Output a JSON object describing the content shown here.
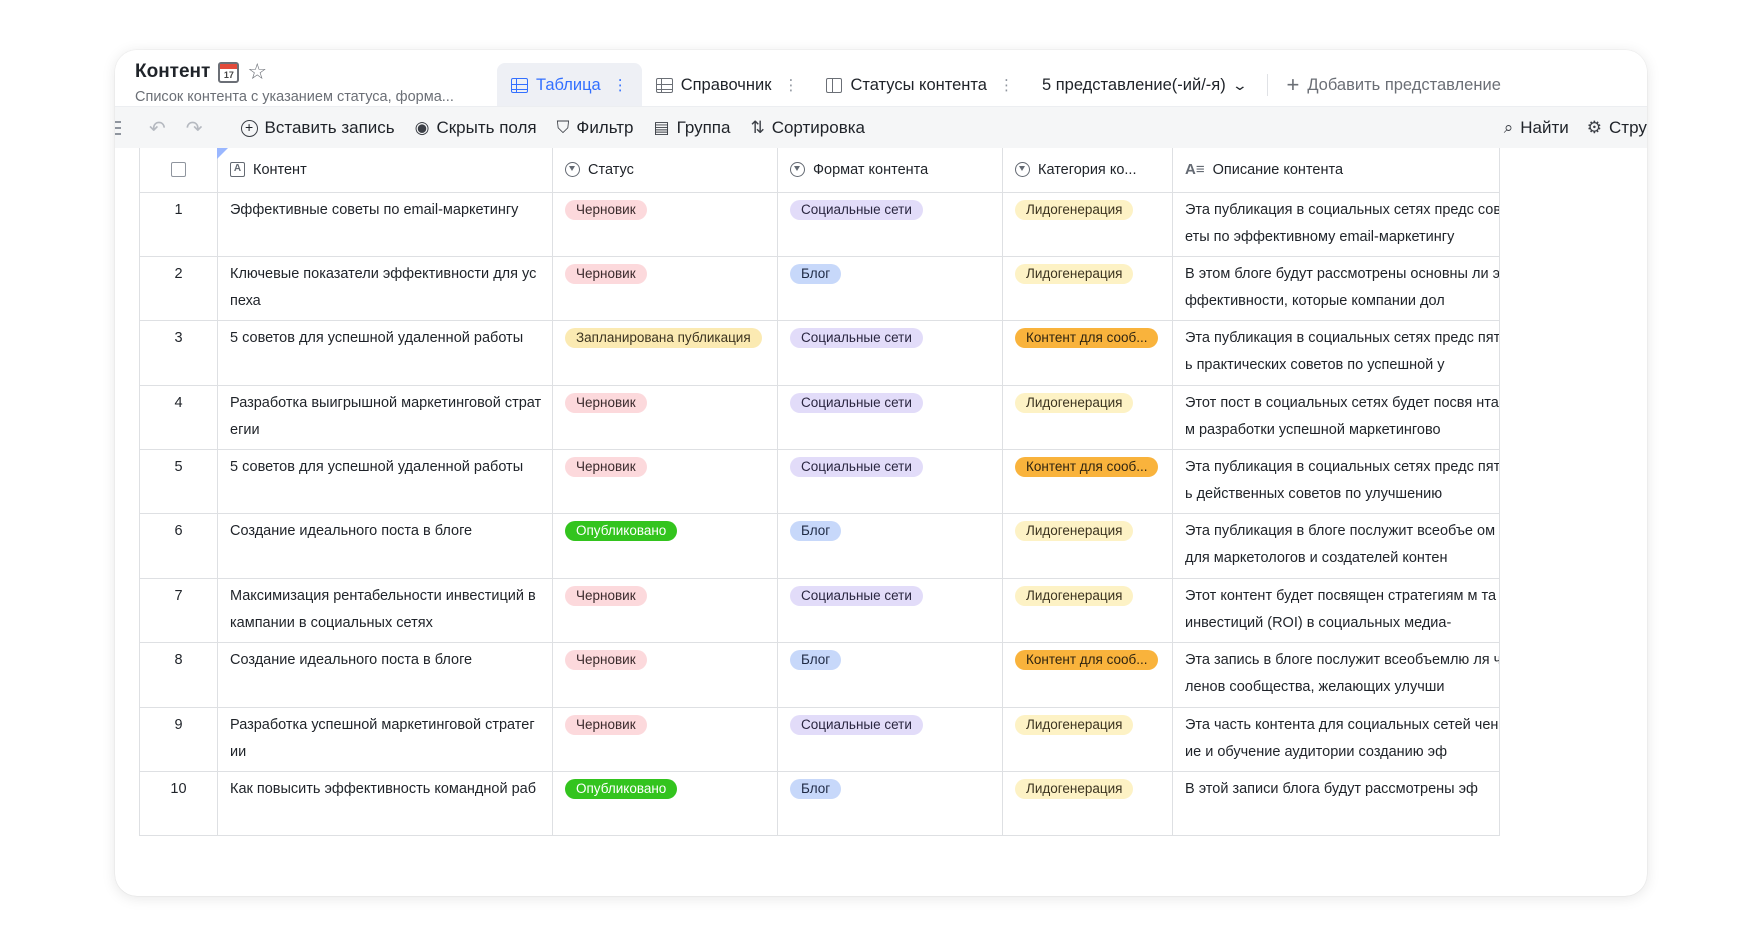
{
  "header": {
    "title": "Контент",
    "calendar_day": "17",
    "subtitle": "Список контента с указанием статуса, форма..."
  },
  "views": {
    "tabs": [
      {
        "label": "Таблица",
        "active": true
      },
      {
        "label": "Справочник",
        "active": false
      },
      {
        "label": "Статусы контента",
        "active": false
      }
    ],
    "dropdown_label": "5 представление(-ий/-я)",
    "add_view_label": "Добавить представление"
  },
  "toolbar": {
    "insert_record": "Вставить запись",
    "hide_fields": "Скрыть поля",
    "filter": "Фильтр",
    "group": "Группа",
    "sort": "Сортировка",
    "find": "Найти",
    "structure": "Стру"
  },
  "table": {
    "columns": [
      "Контент",
      "Статус",
      "Формат контента",
      "Категория ко...",
      "Описание контента"
    ],
    "rows": [
      {
        "num": "1",
        "content": "Эффективные советы по email-маркетингу",
        "status": "Черновик",
        "status_kind": "draft",
        "format": "Социальные сети",
        "format_kind": "social",
        "category": "Лидогенерация",
        "category_kind": "lead",
        "description": "Эта публикация в социальных сетях предс советы по эффективному email-маркетингу"
      },
      {
        "num": "2",
        "content": "Ключевые показатели эффективности для успеха",
        "status": "Черновик",
        "status_kind": "draft",
        "format": "Блог",
        "format_kind": "blog",
        "category": "Лидогенерация",
        "category_kind": "lead",
        "description": "В этом блоге будут рассмотрены основны ли эффективности, которые компании дол"
      },
      {
        "num": "3",
        "content": "5 советов для успешной удаленной работы",
        "status": "Запланирована публикация",
        "status_kind": "planned",
        "format": "Социальные сети",
        "format_kind": "social",
        "category": "Контент для сооб...",
        "category_kind": "comm",
        "description": "Эта публикация в социальных сетях предс пять практических советов по успешной у"
      },
      {
        "num": "4",
        "content": "Разработка выигрышной маркетинговой стратегии",
        "status": "Черновик",
        "status_kind": "draft",
        "format": "Социальные сети",
        "format_kind": "social",
        "category": "Лидогенерация",
        "category_kind": "lead",
        "description": "Этот пост в социальных сетях будет посвя нтам разработки успешной маркетингово"
      },
      {
        "num": "5",
        "content": "5 советов для успешной удаленной работы",
        "status": "Черновик",
        "status_kind": "draft",
        "format": "Социальные сети",
        "format_kind": "social",
        "category": "Контент для сооб...",
        "category_kind": "comm",
        "description": "Эта публикация в социальных сетях предс пять действенных советов по улучшению"
      },
      {
        "num": "6",
        "content": "Создание идеального поста в блоге",
        "status": "Опубликовано",
        "status_kind": "published",
        "format": "Блог",
        "format_kind": "blog",
        "category": "Лидогенерация",
        "category_kind": "lead",
        "description": "Эта публикация в блоге послужит всеобъе ом для маркетологов и создателей контен"
      },
      {
        "num": "7",
        "content": "Максимизация рентабельности инвестиций в кампании в социальных сетях",
        "status": "Черновик",
        "status_kind": "draft",
        "format": "Социальные сети",
        "format_kind": "social",
        "category": "Лидогенерация",
        "category_kind": "lead",
        "description": "Этот контент будет посвящен стратегиям м та инвестиций (ROI) в социальных медиа-"
      },
      {
        "num": "8",
        "content": "Создание идеального поста в блоге",
        "status": "Черновик",
        "status_kind": "draft",
        "format": "Блог",
        "format_kind": "blog",
        "category": "Контент для сооб...",
        "category_kind": "comm",
        "description": "Эта запись в блоге послужит всеобъемлю ля членов сообщества, желающих улучши"
      },
      {
        "num": "9",
        "content": "Разработка успешной маркетинговой стратегии",
        "status": "Черновик",
        "status_kind": "draft",
        "format": "Социальные сети",
        "format_kind": "social",
        "category": "Лидогенерация",
        "category_kind": "lead",
        "description": "Эта часть контента для социальных сетей чение и обучение аудитории созданию эф"
      },
      {
        "num": "10",
        "content": "Как повысить эффективность командной раб",
        "status": "Опубликовано",
        "status_kind": "published",
        "format": "Блог",
        "format_kind": "blog",
        "category": "Лидогенерация",
        "category_kind": "lead",
        "description": "В этой записи блога будут рассмотрены эф"
      }
    ]
  },
  "colors": {
    "accent": "#3370ff",
    "draft": "#fcd9dc",
    "planned": "#fbeab2",
    "published": "#33c41e",
    "social": "#e2dcf9",
    "blog": "#c7d8fa",
    "lead": "#fdf2c5",
    "community": "#f9b33c"
  }
}
